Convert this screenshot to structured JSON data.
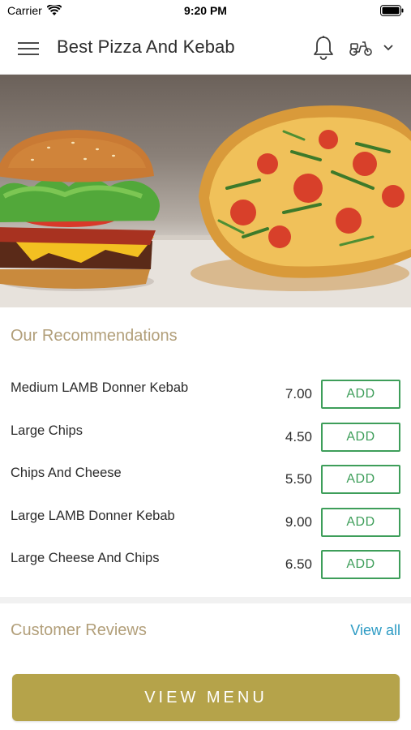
{
  "status_bar": {
    "carrier": "Carrier",
    "time": "9:20 PM",
    "wifi_icon": "wifi-icon",
    "battery_icon": "battery-icon"
  },
  "header": {
    "title": "Best Pizza And Kebab",
    "menu_icon": "hamburger-menu-icon",
    "notification_icon": "bell-icon",
    "delivery_icon": "scooter-icon",
    "dropdown_icon": "chevron-down-icon"
  },
  "hero": {
    "image": "burger-and-pizza-photo"
  },
  "recommendations": {
    "title": "Our Recommendations",
    "items": [
      {
        "name": "Medium LAMB Donner Kebab",
        "price": "7.00",
        "add_label": "ADD"
      },
      {
        "name": "Large Chips",
        "price": "4.50",
        "add_label": "ADD"
      },
      {
        "name": "Chips And Cheese",
        "price": "5.50",
        "add_label": "ADD"
      },
      {
        "name": "Large LAMB Donner Kebab",
        "price": "9.00",
        "add_label": "ADD"
      },
      {
        "name": "Large Cheese And Chips",
        "price": "6.50",
        "add_label": "ADD"
      }
    ]
  },
  "reviews": {
    "title": "Customer Reviews",
    "view_all": "View all"
  },
  "cta": {
    "view_menu": "VIEW MENU"
  },
  "colors": {
    "accent_gold": "#b5a34a",
    "section_title": "#b29f7a",
    "add_green": "#3e9e5a",
    "link_blue": "#2d9bc4"
  }
}
